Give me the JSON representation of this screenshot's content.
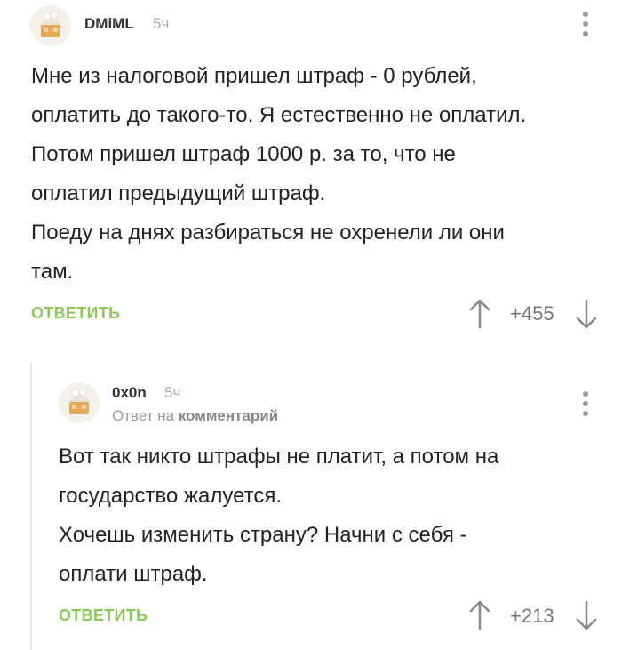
{
  "comments": [
    {
      "username": "DMiML",
      "time": "5ч",
      "lines": [
        "Мне из налоговой пришел штраф - 0 рублей,",
        "оплатить до такого-то. Я естественно не оплатил.",
        "Потом пришел штраф 1000 р. за то, что не",
        "оплатил предыдущий штраф.",
        "Поеду на днях разбираться не охренели ли они",
        "там."
      ],
      "reply_label": "ОТВЕТИТЬ",
      "rating": "+455"
    },
    {
      "username": "0x0n",
      "time": "5ч",
      "reply_prefix": "Ответ на",
      "reply_target": "комментарий",
      "lines": [
        "Вот так никто штрафы не платит, а потом на",
        "государство жалуется.",
        "Хочешь изменить страну? Начни с себя -",
        "оплати штраф."
      ],
      "reply_label": "ОТВЕТИТЬ",
      "rating": "+213"
    }
  ],
  "colors": {
    "accent": "#8ac858",
    "muted": "#aaaaaa",
    "text": "#222222"
  },
  "icons": [
    "avatar-icon",
    "more-vertical-icon",
    "arrow-up-icon",
    "arrow-down-icon"
  ]
}
